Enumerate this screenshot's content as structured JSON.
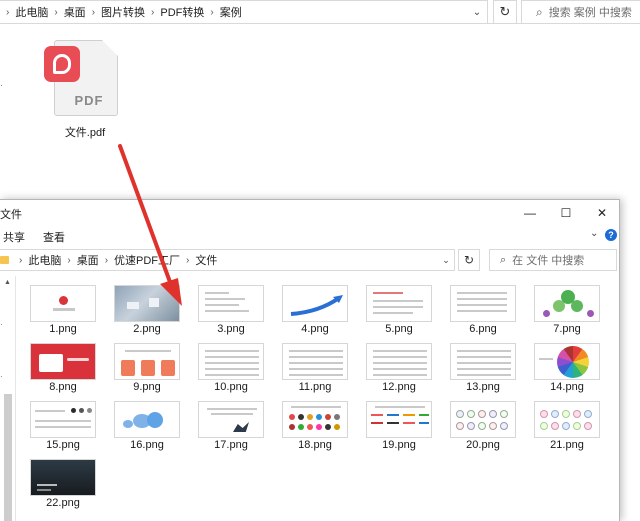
{
  "bg_window": {
    "breadcrumbs": [
      "此电脑",
      "桌面",
      "图片转换",
      "PDF转换",
      "案例"
    ],
    "search_placeholder": "搜索 案例 中搜索",
    "file": {
      "name": "文件.pdf",
      "icon": "pdf-file-icon",
      "badge_text": "PDF"
    }
  },
  "fg_window": {
    "title": "文件",
    "ribbon_tabs": [
      "共享",
      "查看"
    ],
    "breadcrumbs": [
      "此电脑",
      "桌面",
      "优速PDF工厂",
      "文件"
    ],
    "search_placeholder": "在 文件 中搜索",
    "files": [
      "1.png",
      "2.png",
      "3.png",
      "4.png",
      "5.png",
      "6.png",
      "7.png",
      "8.png",
      "9.png",
      "10.png",
      "11.png",
      "12.png",
      "13.png",
      "14.png",
      "15.png",
      "16.png",
      "17.png",
      "18.png",
      "19.png",
      "20.png",
      "21.png",
      "22.png"
    ]
  },
  "colors": {
    "pdf_red": "#e84c55",
    "arrow_red": "#e0322c",
    "folder_yellow": "#f5c451",
    "help_blue": "#1b6ad6"
  }
}
